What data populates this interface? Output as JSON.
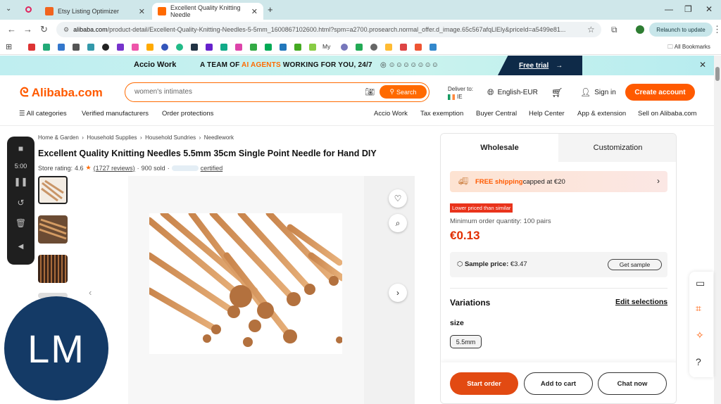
{
  "browser": {
    "tabs": [
      {
        "title": "Etsy Listing Optimizer",
        "active": false
      },
      {
        "title": "Excellent Quality Knitting Needle",
        "active": true
      }
    ],
    "new_tab": "+",
    "url_host": "alibaba.com",
    "url_path": "/product-detail/Excellent-Quality-Knitting-Needles-5-5mm_1600867102600.html?spm=a2700.prosearch.normal_offer.d_image.65c567afqLlEly&priceId=a5499e81...",
    "relaunch": "Relaunch to update",
    "profile_initial": "",
    "bookmarks_my": "My",
    "all_bookmarks": "All Bookmarks"
  },
  "banner": {
    "brand": "Accio Work",
    "message_pre": "A TEAM OF ",
    "message_hl": "AI AGENTS",
    "message_post": " WORKING FOR YOU, 24/7",
    "trial": "Free trial"
  },
  "header": {
    "logo": "Alibaba.com",
    "search_value": "women's intimates",
    "search_button": "Search",
    "deliver_label": "Deliver to:",
    "deliver_country": "IE",
    "language": "English-EUR",
    "sign_in": "Sign in",
    "create_account": "Create account"
  },
  "nav": {
    "all_categories": "All categories",
    "left": [
      "Verified manufacturers",
      "Order protections"
    ],
    "right": [
      "Accio Work",
      "Tax exemption",
      "Buyer Central",
      "Help Center",
      "App & extension",
      "Sell on Alibaba.com"
    ]
  },
  "product": {
    "breadcrumbs": [
      "Home & Garden",
      "Household Supplies",
      "Household Sundries",
      "Needlework"
    ],
    "title": "Excellent Quality Knitting Needles 5.5mm 35cm Single Point Needle for Hand DIY",
    "store_rating_label": "Store rating:",
    "store_rating": "4.6",
    "reviews": "(1727 reviews)",
    "sold": "900 sold",
    "certified": "certified"
  },
  "recorder": {
    "time": "5:00"
  },
  "avatar": {
    "initials": "LM"
  },
  "panel": {
    "tabs": [
      "Wholesale",
      "Customization"
    ],
    "shipping_hl": "FREE shipping",
    "shipping_rest": " capped at €20",
    "low_tag": "Lower priced than similar",
    "moq": "Minimum order quantity: 100 pairs",
    "price": "€0.13",
    "sample_label": "Sample price:",
    "sample_price": "€3.47",
    "get_sample": "Get sample",
    "variations": "Variations",
    "edit_selections": "Edit selections",
    "size_label": "size",
    "size_value": "5.5mm",
    "start_order": "Start order",
    "add_to_cart": "Add to cart",
    "chat_now": "Chat now"
  },
  "colors": {
    "brand": "#ff5a00",
    "price": "#e12e00",
    "banner_dark": "#0e2a48",
    "avatar": "#143a66"
  }
}
